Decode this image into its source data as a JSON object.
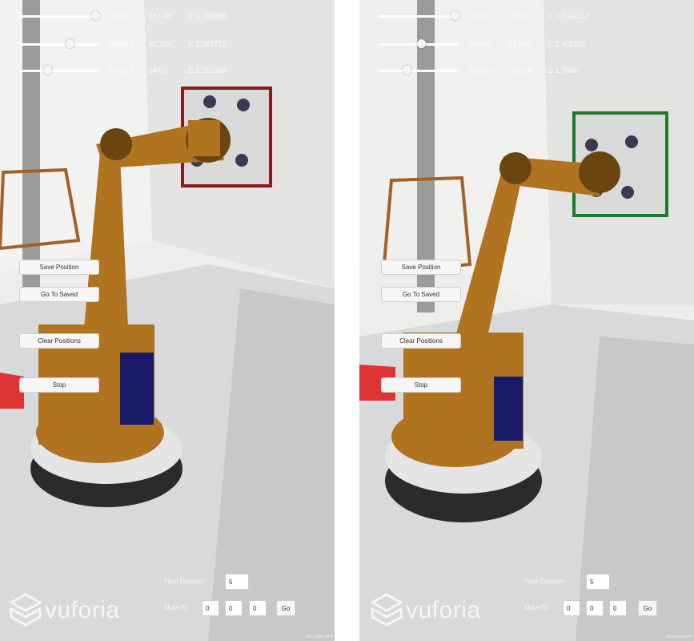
{
  "views": [
    {
      "sliders": [
        {
          "label": "Theta 1",
          "value": "163.68",
          "pos": "X: 1.082883",
          "level": 0.95
        },
        {
          "label": "Theta 2",
          "value": "37.768",
          "pos": "Y: 1.287772",
          "level": 0.63
        },
        {
          "label": "Theta 3",
          "value": "140.5",
          "pos": "Z: 1.251663",
          "level": 0.35
        }
      ],
      "buttons": {
        "save": "Save Position",
        "goto": "Go To Saved",
        "clear": "Clear Positions",
        "stop": "Stop"
      },
      "time_label": "Time Duration:",
      "time_value": "5",
      "move_label": "Move To:",
      "move_values": [
        "0",
        "0",
        "0"
      ],
      "go_label": "Go",
      "target_color": "#8b1a1a"
    },
    {
      "sliders": [
        {
          "label": "Theta 1",
          "value": "169.96",
          "pos": "X: 0.8342114",
          "level": 0.95
        },
        {
          "label": "Theta 2",
          "value": "84.786",
          "pos": "Y: 1.302489",
          "level": 0.53
        },
        {
          "label": "Theta 3",
          "value": "116.144",
          "pos": "Z: 1.7598",
          "level": 0.35
        }
      ],
      "buttons": {
        "save": "Save Position",
        "goto": "Go To Saved",
        "clear": "Clear Positions",
        "stop": "Stop"
      },
      "time_label": "Time Duration:",
      "time_value": "5",
      "move_label": "Move To:",
      "move_values": [
        "0",
        "0",
        "0"
      ],
      "go_label": "Go",
      "target_color": "#1e7a2a"
    }
  ],
  "brand": "vuforia",
  "watermark": "Accepted MP4",
  "colors": {
    "robot": "#b07320",
    "robot_dark": "#6b4510",
    "base": "#2b2b2b",
    "panel": "#1a1a6b",
    "counter": "#d8dadb"
  }
}
